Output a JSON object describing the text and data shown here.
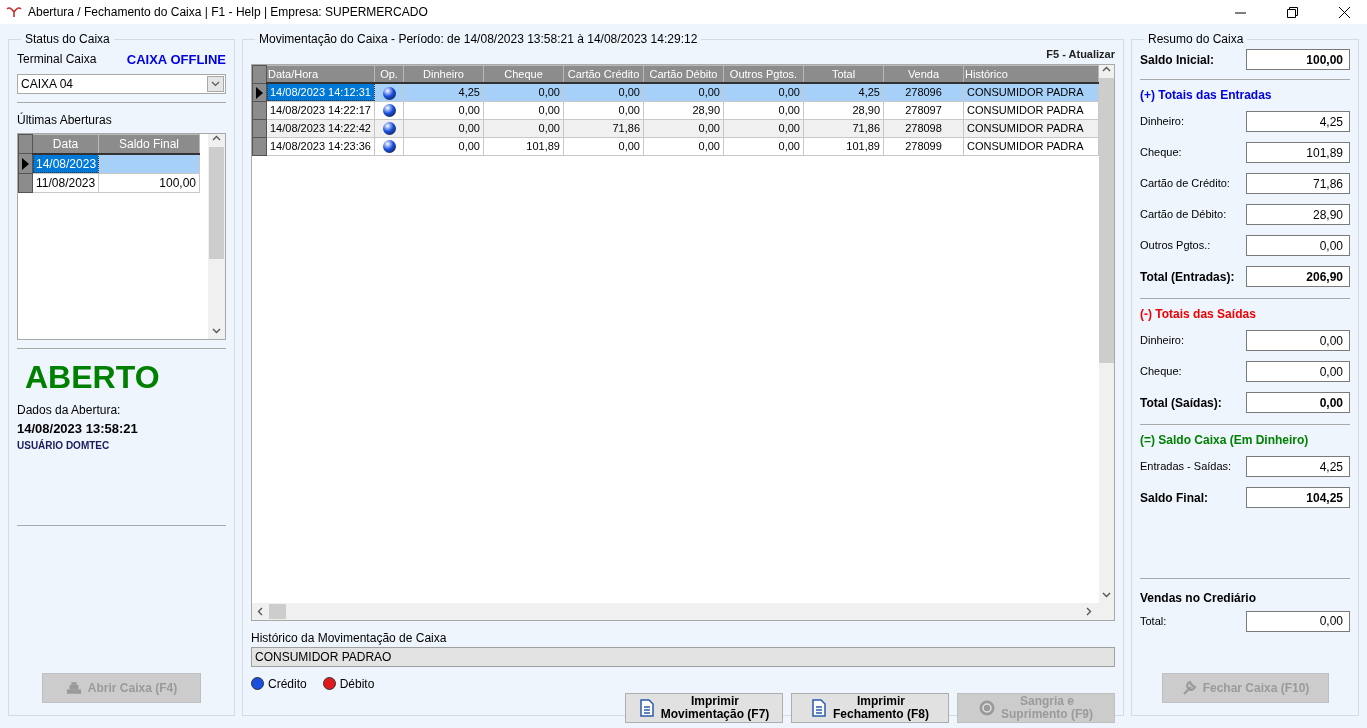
{
  "window": {
    "title": "Abertura / Fechamento do Caixa | F1 - Help | Empresa: SUPERMERCADO"
  },
  "status_panel": {
    "title": "Status do Caixa",
    "terminal_label": "Terminal Caixa",
    "connection": "CAIXA OFFLINE",
    "terminal_value": "CAIXA 04",
    "history_label": "Últimas Aberturas",
    "history_columns": [
      "Data",
      "Saldo Final"
    ],
    "history_rows": [
      {
        "date": "14/08/2023",
        "selected": true
      },
      {
        "date": "11/08/2023",
        "balance": "100,00",
        "selected": false
      }
    ],
    "state": "ABERTO",
    "opening_label": "Dados da Abertura:",
    "opening_datetime": "14/08/2023 13:58:21",
    "opening_user": "USUÁRIO DOMTEC",
    "open_button": {
      "label": "Abrir Caixa (F4)",
      "disabled": true
    }
  },
  "movement_panel": {
    "title": "Movimentação do Caixa - Período: de 14/08/2023 13:58:21 à 14/08/2023 14:29:12",
    "refresh_hint": "F5 - Atualizar",
    "columns": [
      "Data/Hora",
      "Op.",
      "Dinheiro",
      "Cheque",
      "Cartão Crédito",
      "Cartão Débito",
      "Outros Pgtos.",
      "Total",
      "Venda",
      "Histórico"
    ],
    "rows": [
      {
        "date_time": "14/08/2023 14:12:31",
        "kind": "credit",
        "values": [
          "4,25",
          "0,00",
          "0,00",
          "0,00",
          "0,00",
          "4,25",
          "278096"
        ],
        "history": "CONSUMIDOR PADRA",
        "selected": true
      },
      {
        "date_time": "14/08/2023 14:22:17",
        "kind": "credit",
        "values": [
          "0,00",
          "0,00",
          "0,00",
          "28,90",
          "0,00",
          "28,90",
          "278097"
        ],
        "history": "CONSUMIDOR PADRA",
        "selected": false
      },
      {
        "date_time": "14/08/2023 14:22:42",
        "kind": "credit",
        "values": [
          "0,00",
          "0,00",
          "71,86",
          "0,00",
          "0,00",
          "71,86",
          "278098"
        ],
        "history": "CONSUMIDOR PADRA",
        "selected": false
      },
      {
        "date_time": "14/08/2023 14:23:36",
        "kind": "credit",
        "values": [
          "0,00",
          "101,89",
          "0,00",
          "0,00",
          "0,00",
          "101,89",
          "278099"
        ],
        "history": "CONSUMIDOR PADRA",
        "selected": false
      }
    ],
    "history_label": "Histórico da Movimentação de Caixa",
    "history_value": "CONSUMIDOR PADRAO",
    "legend": [
      {
        "label": "Crédito",
        "color": "#1a4fe0"
      },
      {
        "label": "Débito",
        "color": "#e01a1a"
      }
    ],
    "buttons": [
      {
        "lines": [
          "Imprimir",
          "Movimentação (F7)"
        ],
        "kind": "print",
        "disabled": false
      },
      {
        "lines": [
          "Imprimir",
          "Fechamento (F8)"
        ],
        "kind": "print",
        "disabled": false
      },
      {
        "lines": [
          "Sangria e",
          "Suprimento (F9)"
        ],
        "kind": "cash",
        "disabled": true
      }
    ]
  },
  "summary_panel": {
    "title": "Resumo do Caixa",
    "opening": {
      "label": "Saldo Inicial:",
      "value": "100,00"
    },
    "sections": [
      {
        "kind": "entries",
        "heading": "(+) Totais das Entradas",
        "rows": [
          {
            "label": "Dinheiro:",
            "value": "4,25"
          },
          {
            "label": "Cheque:",
            "value": "101,89"
          },
          {
            "label": "Cartão de Crédito:",
            "value": "71,86"
          },
          {
            "label": "Cartão de Débito:",
            "value": "28,90"
          },
          {
            "label": "Outros Pgtos.:",
            "value": "0,00"
          }
        ],
        "total": {
          "label": "Total (Entradas):",
          "value": "206,90"
        }
      },
      {
        "kind": "exits",
        "heading": "(-) Totais das Saídas",
        "rows": [
          {
            "label": "Dinheiro:",
            "value": "0,00"
          },
          {
            "label": "Cheque:",
            "value": "0,00"
          }
        ],
        "total": {
          "label": "Total (Saídas):",
          "value": "0,00"
        }
      },
      {
        "kind": "balance",
        "heading": "(=) Saldo Caixa (Em Dinheiro)",
        "rows": [
          {
            "label": "Entradas - Saídas:",
            "value": "4,25"
          }
        ],
        "total": {
          "label": "Saldo Final:",
          "value": "104,25"
        }
      }
    ],
    "credit_sales": {
      "heading": "Vendas no Crediário",
      "rows": [
        {
          "label": "Total:",
          "value": "0,00"
        }
      ]
    },
    "close_button": {
      "label": "Fechar Caixa (F10)",
      "disabled": true
    }
  }
}
